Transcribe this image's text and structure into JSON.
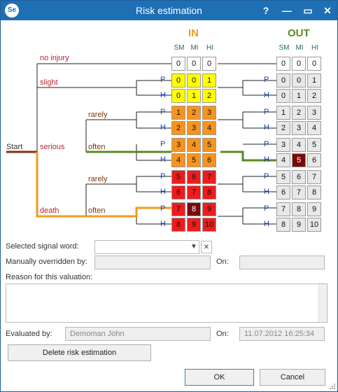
{
  "window": {
    "title": "Risk estimation",
    "icon_text": "Se",
    "help_label": "?",
    "minimize_label": "—",
    "maximize_label": "▭",
    "close_label": "✕"
  },
  "matrix": {
    "in_label": "IN",
    "out_label": "OUT",
    "columns": [
      "SM",
      "MI",
      "HI"
    ],
    "in_rows": [
      {
        "values": [
          "0",
          "0",
          "0"
        ],
        "color": "#ffffff"
      },
      {
        "values": [
          "0",
          "0",
          "1"
        ],
        "color": "#ffff00"
      },
      {
        "values": [
          "0",
          "1",
          "2"
        ],
        "color": "#ffff00"
      },
      {
        "values": [
          "1",
          "2",
          "3"
        ],
        "color": "#f7941d"
      },
      {
        "values": [
          "2",
          "3",
          "4"
        ],
        "color": "#f7941d"
      },
      {
        "values": [
          "3",
          "4",
          "5"
        ],
        "color": "#f7941d"
      },
      {
        "values": [
          "4",
          "5",
          "6"
        ],
        "color": "#f7941d"
      },
      {
        "values": [
          "5",
          "6",
          "7"
        ],
        "color": "#ee1c1c"
      },
      {
        "values": [
          "6",
          "7",
          "8"
        ],
        "color": "#ee1c1c"
      },
      {
        "values": [
          "7",
          "8",
          "9"
        ],
        "color": "#ee1c1c"
      },
      {
        "values": [
          "8",
          "9",
          "10"
        ],
        "color": "#ee1c1c"
      }
    ],
    "out_rows": [
      [
        "0",
        "0",
        "0"
      ],
      [
        "0",
        "0",
        "1"
      ],
      [
        "0",
        "1",
        "2"
      ],
      [
        "1",
        "2",
        "3"
      ],
      [
        "2",
        "3",
        "4"
      ],
      [
        "3",
        "4",
        "5"
      ],
      [
        "4",
        "5",
        "6"
      ],
      [
        "5",
        "6",
        "7"
      ],
      [
        "6",
        "7",
        "8"
      ],
      [
        "7",
        "8",
        "9"
      ],
      [
        "8",
        "9",
        "10"
      ]
    ],
    "in_selected": {
      "row": 9,
      "col": 1
    },
    "out_selected": {
      "row": 6,
      "col": 1
    }
  },
  "tree": {
    "start": "Start",
    "severity": [
      "no injury",
      "slight",
      "serious",
      "death"
    ],
    "frequency": {
      "serious_a": "rarely",
      "serious_b": "often",
      "death_a": "rarely",
      "death_b": "often"
    },
    "ph": [
      "P",
      "H"
    ],
    "path_in_color": "#f39a1c",
    "path_out_color": "#5a8a21",
    "start_color": "#7a3510"
  },
  "form": {
    "signal_word_label": "Selected signal word:",
    "signal_word_value": "",
    "overridden_label": "Manually overridden by:",
    "overridden_value": "",
    "on_label": "On:",
    "on_value": "",
    "reason_label": "Reason for this valuation:",
    "reason_value": "",
    "evaluated_label": "Evaluated by:",
    "evaluated_value": "Demoman John",
    "evaluated_on_label": "On:",
    "evaluated_on_value": "11.07.2012 16:25:34",
    "delete_button": "Delete risk estimation",
    "ok_button": "OK",
    "cancel_button": "Cancel"
  }
}
